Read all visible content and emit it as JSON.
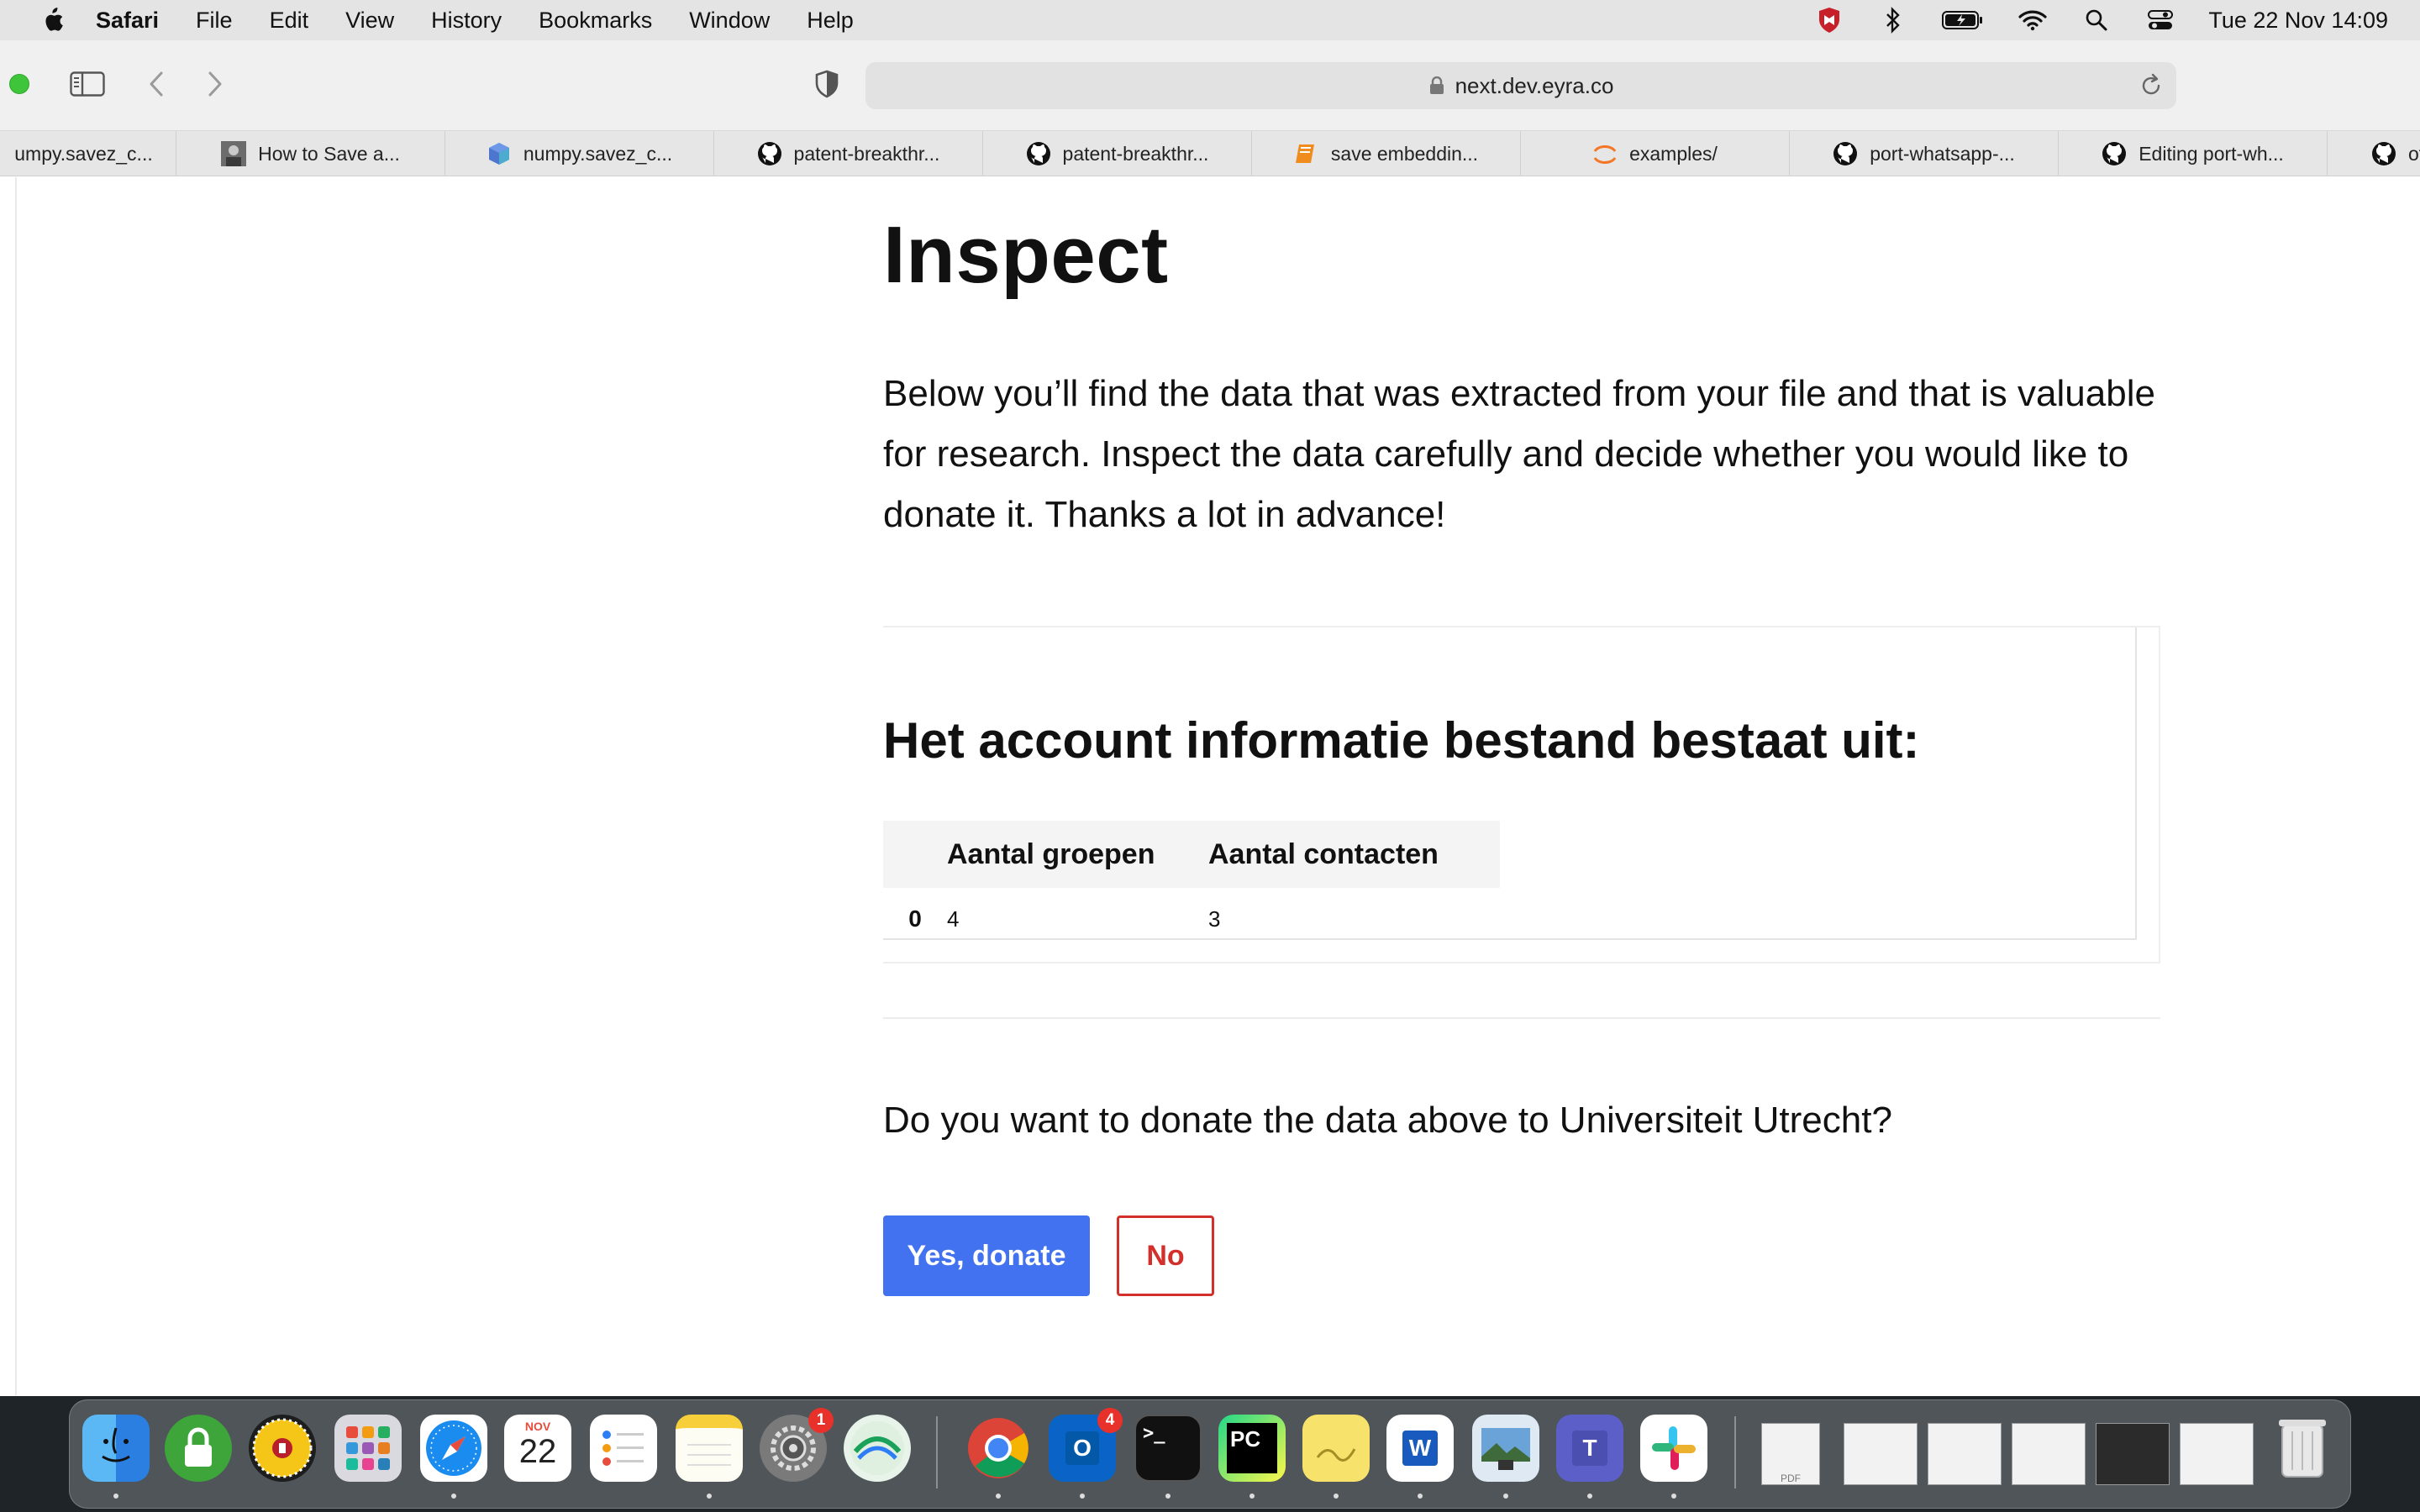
{
  "menubar": {
    "app_name": "Safari",
    "menus": [
      "File",
      "Edit",
      "View",
      "History",
      "Bookmarks",
      "Window",
      "Help"
    ],
    "clock": "Tue 22 Nov  14:09"
  },
  "toolbar": {
    "url": "next.dev.eyra.co"
  },
  "tabs": [
    {
      "label": "umpy.savez_c...",
      "icon": "partial-tab"
    },
    {
      "label": "How to Save a...",
      "icon": "avatar-favicon"
    },
    {
      "label": "numpy.savez_c...",
      "icon": "numpy-favicon"
    },
    {
      "label": "patent-breakthr...",
      "icon": "github-favicon"
    },
    {
      "label": "patent-breakthr...",
      "icon": "github-favicon"
    },
    {
      "label": "save embeddin...",
      "icon": "book-favicon"
    },
    {
      "label": "examples/",
      "icon": "jupyter-favicon"
    },
    {
      "label": "port-whatsapp-...",
      "icon": "github-favicon"
    },
    {
      "label": "Editing port-wh...",
      "icon": "github-favicon"
    },
    {
      "label": "ot",
      "icon": "github-favicon"
    }
  ],
  "page": {
    "title": "Inspect",
    "intro": "Below you’ll find the data that was extracted from your file and that is valuable for research. Inspect the data carefully and decide whether you would like to donate it. Thanks a lot in advance!",
    "card_title": "Het account informatie bestand bestaat uit:",
    "table": {
      "headers": [
        "",
        "Aantal groepen",
        "Aantal contacten"
      ],
      "rows": [
        [
          "0",
          "4",
          "3"
        ]
      ]
    },
    "question": "Do you want to donate the data above to Universiteit Utrecht?",
    "yes_label": "Yes, donate",
    "no_label": "No",
    "colors": {
      "primary": "#4272ef",
      "danger": "#d4302b"
    }
  },
  "dock": {
    "calendar_month": "NOV",
    "calendar_day": "22",
    "settings_badge": "1",
    "outlook_badge": "4",
    "apps": [
      "finder",
      "lock",
      "sunflower",
      "launchpad",
      "safari",
      "calendar",
      "reminders",
      "notes",
      "system-settings",
      "maps",
      "chrome",
      "outlook",
      "terminal",
      "pycharm",
      "stickies",
      "word",
      "preview",
      "teams",
      "slack",
      "pdf-doc",
      "chrome-window",
      "notes-window",
      "finder-window",
      "pycharm-window",
      "window",
      "trash"
    ],
    "terminal_text": ">_",
    "pycharm_text": "PC",
    "word_text": "W",
    "outlook_text": "O",
    "teams_text": "T",
    "pdf_text": "PDF"
  }
}
